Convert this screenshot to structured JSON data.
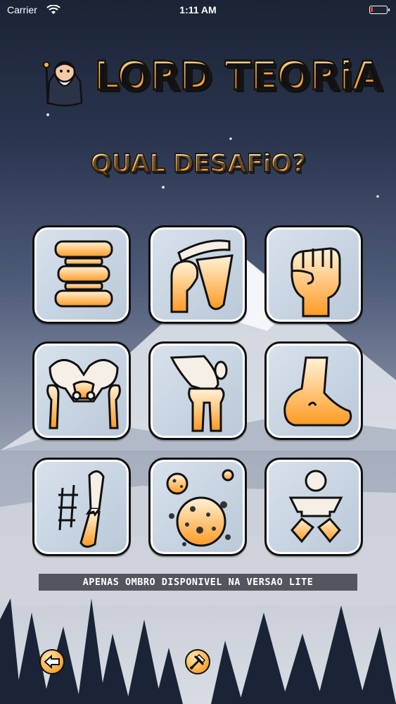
{
  "status_bar": {
    "carrier": "Carrier",
    "time": "1:11 AM"
  },
  "header": {
    "title": "LORD TEORiA",
    "subtitle": "QUAL DESAFiO?"
  },
  "challenges": [
    {
      "icon": "spine-icon"
    },
    {
      "icon": "shoulder-icon"
    },
    {
      "icon": "hand-fist-icon"
    },
    {
      "icon": "pelvis-hip-icon"
    },
    {
      "icon": "knee-icon"
    },
    {
      "icon": "foot-icon"
    },
    {
      "icon": "bone-fracture-icon"
    },
    {
      "icon": "bone-tumor-icon"
    },
    {
      "icon": "pediatric-icon"
    }
  ],
  "notice": "APENAS OMBRO DISPONIVEL NA VERSAO LITE",
  "footer": {
    "back_icon": "back-arrow-icon",
    "tools_icon": "hammer-wrench-icon"
  },
  "colors": {
    "accent_orange": "#ffa43a",
    "outline": "#101010",
    "tile_bg": "#c8d5e2"
  }
}
